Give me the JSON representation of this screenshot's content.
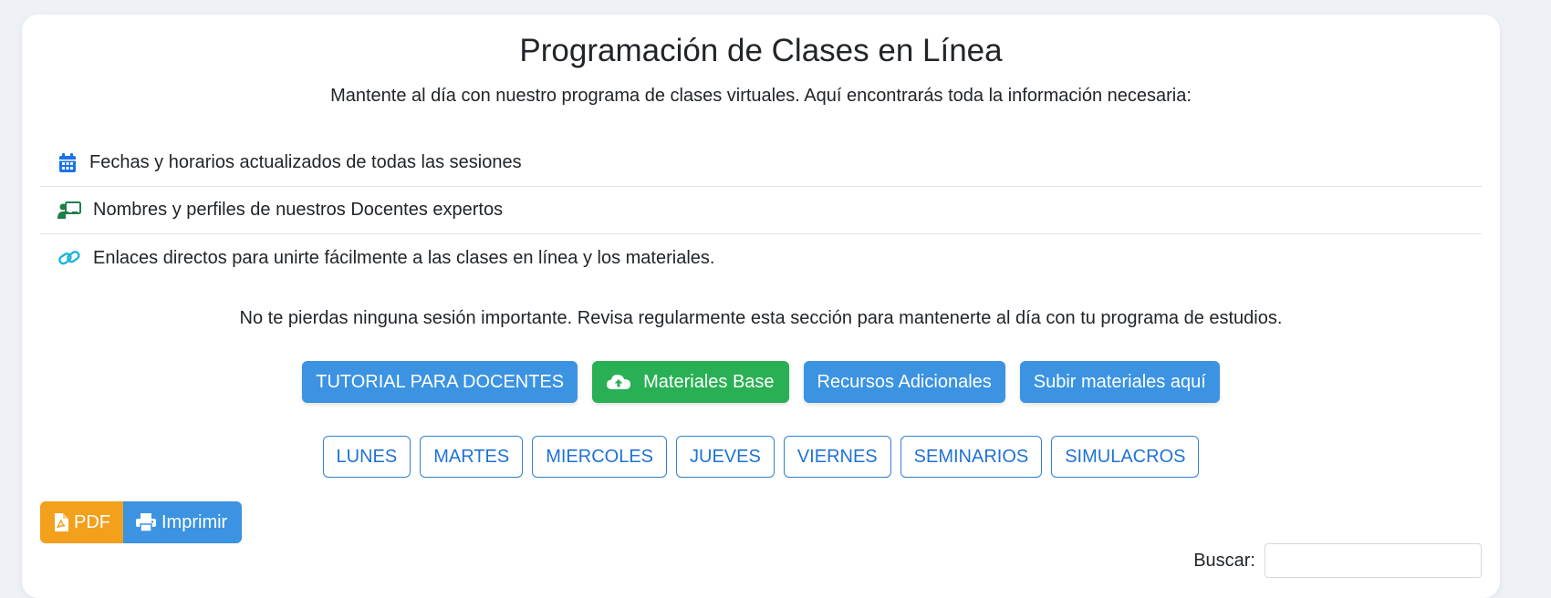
{
  "header": {
    "title": "Programación de Clases en Línea",
    "subtitle": "Mantente al día con nuestro programa de clases virtuales. Aquí encontrarás toda la información necesaria:"
  },
  "features": [
    {
      "icon": "calendar-icon",
      "color": "#1a73e8",
      "text": "Fechas y horarios actualizados de todas las sesiones"
    },
    {
      "icon": "teacher-board-icon",
      "color": "#1e7e4a",
      "text": "Nombres y perfiles de nuestros Docentes expertos"
    },
    {
      "icon": "link-icon",
      "color": "#1bb5d8",
      "text": "Enlaces directos para unirte fácilmente a las clases en línea y los materiales."
    }
  ],
  "note": "No te pierdas ninguna sesión importante. Revisa regularmente esta sección para mantenerte al día con tu programa de estudios.",
  "actions": {
    "tutorial": "TUTORIAL PARA DOCENTES",
    "materiales": "Materiales Base",
    "recursos": "Recursos Adicionales",
    "subir": "Subir materiales aquí"
  },
  "days": [
    "LUNES",
    "MARTES",
    "MIERCOLES",
    "JUEVES",
    "VIERNES",
    "SEMINARIOS",
    "SIMULACROS"
  ],
  "export": {
    "pdf": "PDF",
    "print": "Imprimir"
  },
  "search": {
    "label": "Buscar:",
    "value": ""
  },
  "colors": {
    "primary": "#3b93e2",
    "success": "#2ab054",
    "warning": "#f3a01d",
    "outline": "#1f72d6"
  }
}
